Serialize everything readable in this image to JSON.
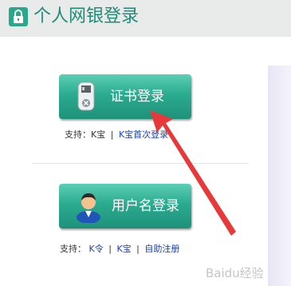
{
  "header": {
    "title": "个人网银登录",
    "icon": "lock-icon",
    "accent_color": "#2aa88c",
    "title_color": "#1f8c78"
  },
  "cert_login": {
    "label": "证书登录",
    "icon": "usb-key-icon",
    "support_prefix": "支持：K宝",
    "support_sep": "|",
    "support_link": "K宝首次登录"
  },
  "user_login": {
    "label": "用户名登录",
    "icon": "user-icon",
    "support_prefix": "支持：",
    "links": [
      "K令",
      "K宝",
      "自助注册"
    ],
    "sep": "|"
  },
  "watermark": "Baidu经验",
  "colors": {
    "button_top": "#5dcfb6",
    "button_bottom": "#1e9179",
    "link": "#1a3fb8",
    "arrow": "#e8393a"
  }
}
